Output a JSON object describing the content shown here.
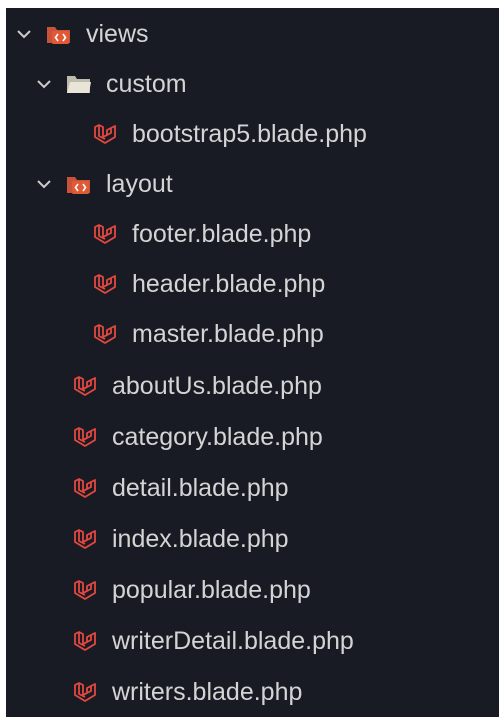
{
  "explorer": {
    "items": [
      {
        "label": "views",
        "type": "folder",
        "icon": "folder-views-icon",
        "depth": 0,
        "expanded": true
      },
      {
        "label": "custom",
        "type": "folder",
        "icon": "folder-icon",
        "depth": 1,
        "expanded": true
      },
      {
        "label": "bootstrap5.blade.php",
        "type": "file",
        "icon": "laravel-icon",
        "depth": 2
      },
      {
        "label": "layout",
        "type": "folder",
        "icon": "folder-views-icon",
        "depth": 1,
        "expanded": true
      },
      {
        "label": "footer.blade.php",
        "type": "file",
        "icon": "laravel-icon",
        "depth": 2
      },
      {
        "label": "header.blade.php",
        "type": "file",
        "icon": "laravel-icon",
        "depth": 2
      },
      {
        "label": "master.blade.php",
        "type": "file",
        "icon": "laravel-icon",
        "depth": 2
      },
      {
        "label": "aboutUs.blade.php",
        "type": "file",
        "icon": "laravel-icon",
        "depth": 1
      },
      {
        "label": "category.blade.php",
        "type": "file",
        "icon": "laravel-icon",
        "depth": 1
      },
      {
        "label": "detail.blade.php",
        "type": "file",
        "icon": "laravel-icon",
        "depth": 1
      },
      {
        "label": "index.blade.php",
        "type": "file",
        "icon": "laravel-icon",
        "depth": 1
      },
      {
        "label": "popular.blade.php",
        "type": "file",
        "icon": "laravel-icon",
        "depth": 1
      },
      {
        "label": "writerDetail.blade.php",
        "type": "file",
        "icon": "laravel-icon",
        "depth": 1
      },
      {
        "label": "writers.blade.php",
        "type": "file",
        "icon": "laravel-icon",
        "depth": 1
      }
    ]
  },
  "colors": {
    "background": "#181b24",
    "text": "#d4d4d4",
    "laravel": "#e5483f",
    "folder": "#e8e4d8",
    "views_folder_red": "#e05a35"
  }
}
